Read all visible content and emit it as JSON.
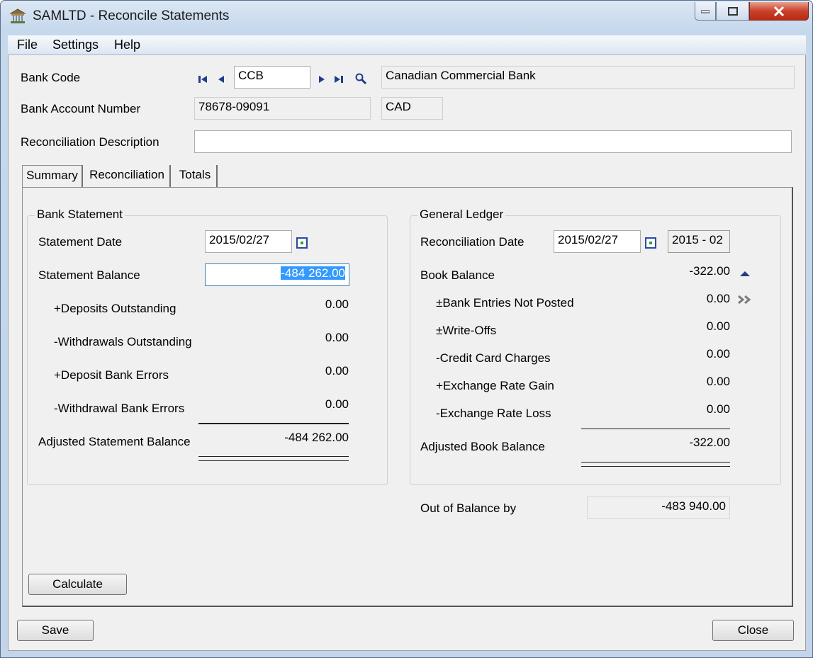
{
  "window": {
    "title": "SAMLTD - Reconcile Statements"
  },
  "menu": {
    "file": "File",
    "settings": "Settings",
    "help": "Help"
  },
  "header": {
    "bank_code_label": "Bank Code",
    "bank_code_value": "CCB",
    "bank_name": "Canadian Commercial Bank",
    "account_number_label": "Bank Account Number",
    "account_number_value": "78678-09091",
    "currency": "CAD",
    "description_label": "Reconciliation Description",
    "description_value": ""
  },
  "tabs": {
    "summary": "Summary",
    "reconciliation": "Reconciliation",
    "totals": "Totals"
  },
  "bank_statement": {
    "title": "Bank Statement",
    "statement_date_label": "Statement Date",
    "statement_date_value": "2015/02/27",
    "statement_balance_label": "Statement Balance",
    "statement_balance_value": "-484 262.00",
    "deposits_outstanding_label": "+Deposits Outstanding",
    "deposits_outstanding_value": "0.00",
    "withdrawals_outstanding_label": "-Withdrawals Outstanding",
    "withdrawals_outstanding_value": "0.00",
    "deposit_bank_errors_label": "+Deposit Bank Errors",
    "deposit_bank_errors_value": "0.00",
    "withdrawal_bank_errors_label": "-Withdrawal Bank Errors",
    "withdrawal_bank_errors_value": "0.00",
    "adjusted_label": "Adjusted Statement Balance",
    "adjusted_value": "-484 262.00"
  },
  "general_ledger": {
    "title": "General Ledger",
    "recon_date_label": "Reconciliation Date",
    "recon_date_value": "2015/02/27",
    "period_value": "2015 - 02",
    "book_balance_label": "Book Balance",
    "book_balance_value": "-322.00",
    "bank_entries_label": "±Bank Entries Not Posted",
    "bank_entries_value": "0.00",
    "write_offs_label": "±Write-Offs",
    "write_offs_value": "0.00",
    "credit_card_label": "-Credit Card Charges",
    "credit_card_value": "0.00",
    "exchange_gain_label": "+Exchange Rate Gain",
    "exchange_gain_value": "0.00",
    "exchange_loss_label": "-Exchange Rate Loss",
    "exchange_loss_value": "0.00",
    "adjusted_label": "Adjusted Book Balance",
    "adjusted_value": "-322.00"
  },
  "out_of_balance": {
    "label": "Out of Balance by",
    "value": "-483 940.00"
  },
  "buttons": {
    "calculate": "Calculate",
    "save": "Save",
    "close": "Close"
  },
  "icons": {
    "app": "bank-building-icon",
    "first": "first-record-icon",
    "prev": "previous-record-icon",
    "next": "next-record-icon",
    "last": "last-record-icon",
    "finder": "magnifier-icon",
    "calendar": "calendar-icon",
    "collapse": "collapse-up-icon",
    "drilldown": "drilldown-icon"
  }
}
